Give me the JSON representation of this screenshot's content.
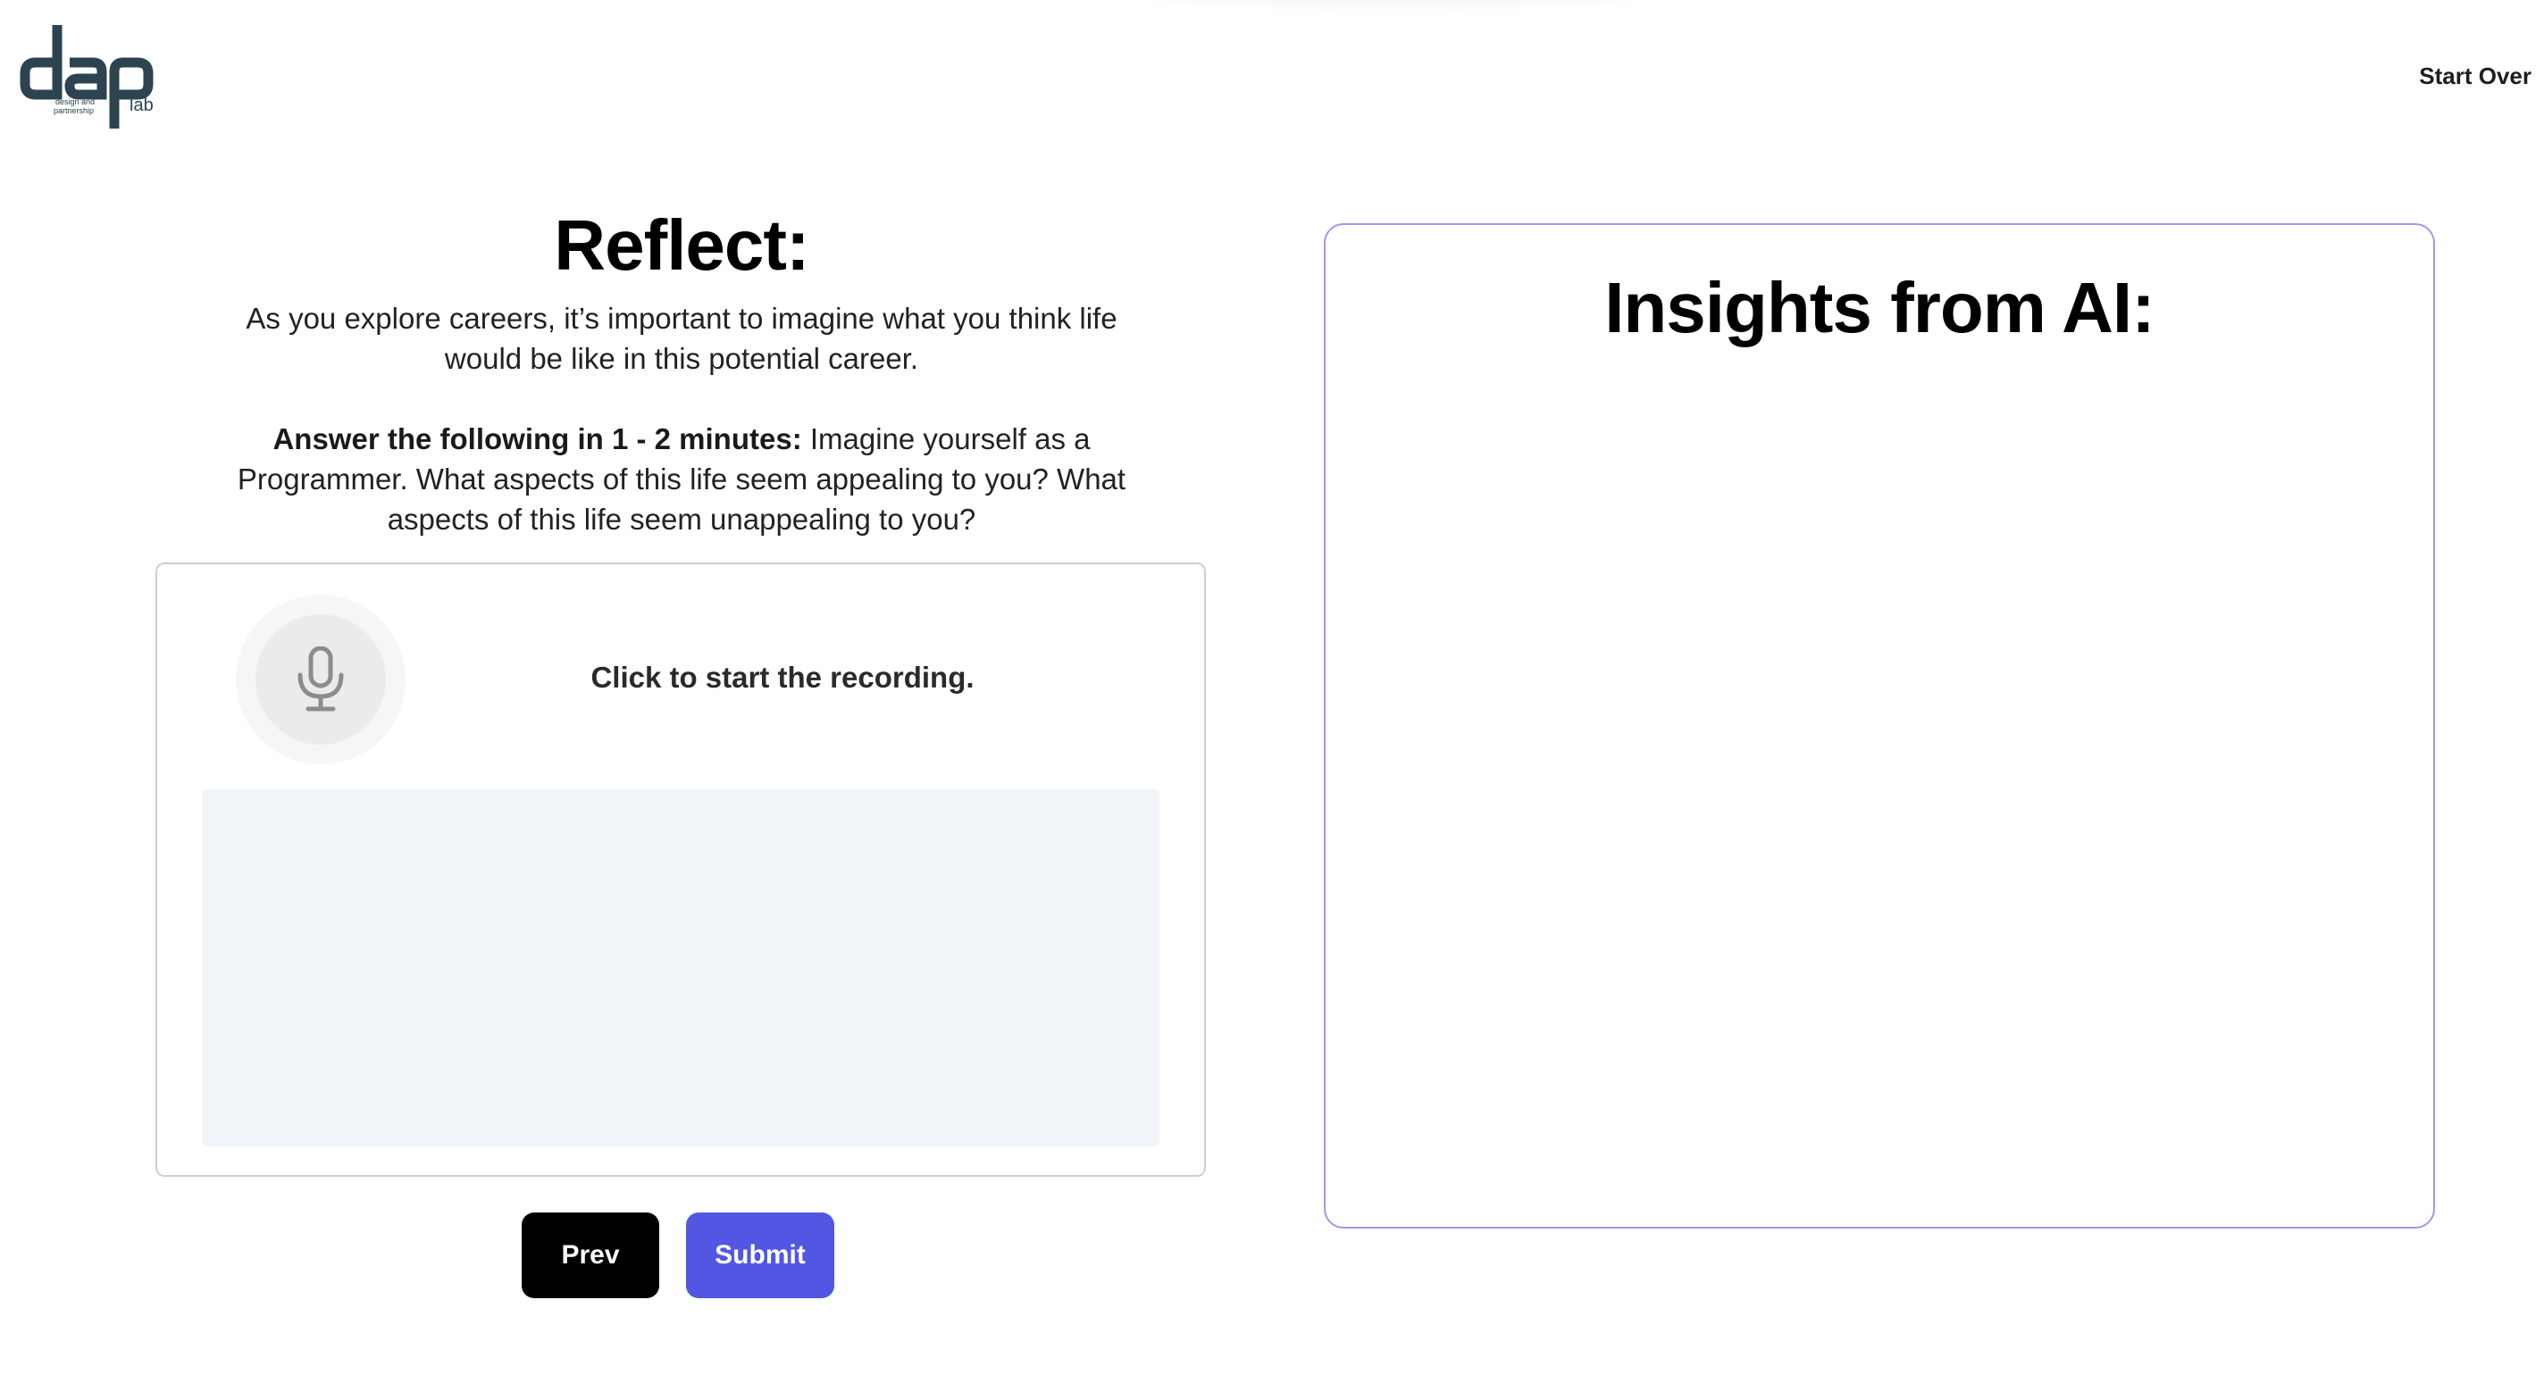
{
  "header": {
    "logo_main": "dap",
    "logo_sub": "design and partnership",
    "logo_lab": "lab",
    "start_over_label": "Start Over"
  },
  "reflect": {
    "title": "Reflect:",
    "intro": "As you explore careers, it’s important to imagine what you think life would be like in this potential career.",
    "prompt_bold": "Answer the following in 1 - 2 minutes:",
    "prompt_text": " Imagine yourself as a Programmer. What aspects of this life seem appealing to you? What aspects of this life seem unappealing to you?"
  },
  "recorder": {
    "icon": "microphone-icon",
    "label": "Click to start the recording.",
    "transcript": ""
  },
  "buttons": {
    "prev_label": "Prev",
    "submit_label": "Submit"
  },
  "insights": {
    "title": "Insights from AI:",
    "content": ""
  },
  "colors": {
    "submit": "#5356e3",
    "prev": "#000000",
    "insights_border": "#9a9be8",
    "logo": "#2b4450",
    "transcript_bg": "#f1f4f9"
  }
}
